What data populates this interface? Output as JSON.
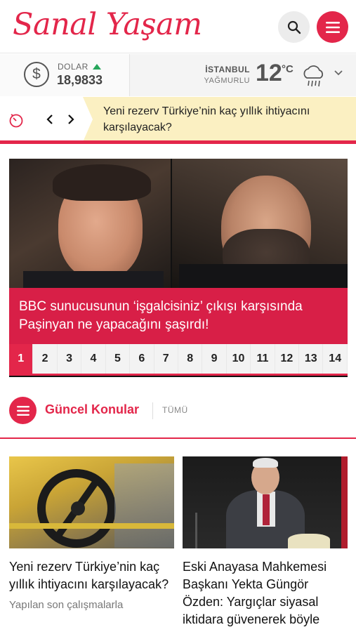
{
  "header": {
    "logo_text": "Sanal Yaşam",
    "search_icon": "search-icon",
    "menu_icon": "hamburger-icon",
    "brand_color": "#e3264a"
  },
  "market": {
    "currency_icon": "dollar-icon",
    "name": "DOLAR",
    "trend": "up",
    "value": "18,9833"
  },
  "weather": {
    "city": "İSTANBUL",
    "condition": "YAĞMURLU",
    "temperature": "12",
    "unit": "°C",
    "icon": "rain-cloud-icon"
  },
  "ticker": {
    "icon": "clock-icon",
    "text": "Yeni rezerv Türkiye’nin kaç yıllık ihtiyacını karşılayacak?"
  },
  "slider": {
    "title": "BBC sunucusunun ‘işgalcisiniz’ çıkışı karşısında Paşinyan ne yapacağını şaşırdı!",
    "pages": [
      "1",
      "2",
      "3",
      "4",
      "5",
      "6",
      "7",
      "8",
      "9",
      "10",
      "11",
      "12",
      "13",
      "14"
    ],
    "active_page": "1"
  },
  "section": {
    "icon": "hamburger-icon",
    "title": "Güncel Konular",
    "all_label": "TÜMÜ"
  },
  "cards": [
    {
      "title": "Yeni rezerv Türkiye’nin kaç yıllık ihtiyacını karşılayacak?",
      "summary": "Yapılan son çalışmalarla"
    },
    {
      "title": "Eski Anayasa Mahkemesi Başkanı Yekta Güngör Özden: Yargıçlar siyasal iktidara güvenerek böyle"
    }
  ]
}
